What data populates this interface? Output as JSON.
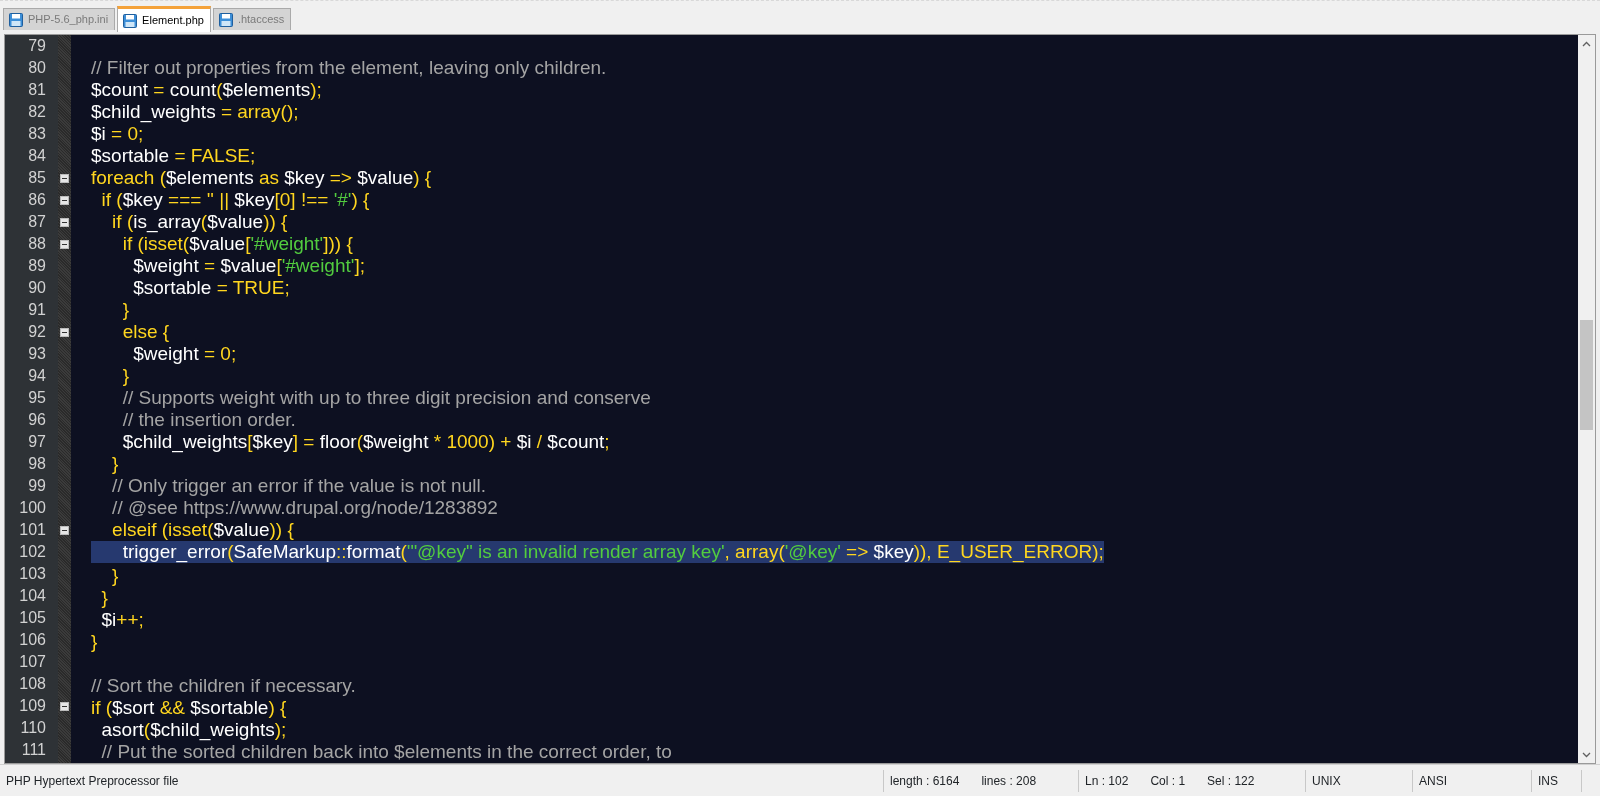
{
  "tabs": [
    {
      "label": "PHP-5.6_php.ini",
      "selected": false
    },
    {
      "label": "Element.php",
      "selected": true
    },
    {
      "label": ".htaccess",
      "selected": false
    }
  ],
  "editor": {
    "lines": [
      {
        "number": "79",
        "fold": false,
        "selected": false
      },
      {
        "number": "80",
        "fold": false,
        "selected": false,
        "tokens": [
          {
            "text": "// Filter out properties from the element, leaving only children.",
            "kind": "comment"
          }
        ]
      },
      {
        "number": "81",
        "fold": false,
        "selected": false,
        "tokens": [
          {
            "text": "$count ",
            "kind": "plain"
          },
          {
            "text": "= ",
            "kind": "keyword"
          },
          {
            "text": "count",
            "kind": "plain"
          },
          {
            "text": "(",
            "kind": "keyword"
          },
          {
            "text": "$elements",
            "kind": "plain"
          },
          {
            "text": ");",
            "kind": "keyword"
          }
        ]
      },
      {
        "number": "82",
        "fold": false,
        "selected": false,
        "tokens": [
          {
            "text": "$child_weights ",
            "kind": "plain"
          },
          {
            "text": "= array();",
            "kind": "keyword"
          }
        ]
      },
      {
        "number": "83",
        "fold": false,
        "selected": false,
        "tokens": [
          {
            "text": "$i ",
            "kind": "plain"
          },
          {
            "text": "= 0;",
            "kind": "keyword"
          }
        ]
      },
      {
        "number": "84",
        "fold": false,
        "selected": false,
        "tokens": [
          {
            "text": "$sortable ",
            "kind": "plain"
          },
          {
            "text": "= FALSE;",
            "kind": "keyword"
          }
        ]
      },
      {
        "number": "85",
        "fold": true,
        "selected": false,
        "tokens": [
          {
            "text": "foreach (",
            "kind": "keyword"
          },
          {
            "text": "$elements ",
            "kind": "plain"
          },
          {
            "text": "as ",
            "kind": "keyword"
          },
          {
            "text": "$key ",
            "kind": "plain"
          },
          {
            "text": "=> ",
            "kind": "keyword"
          },
          {
            "text": "$value",
            "kind": "plain"
          },
          {
            "text": ") {",
            "kind": "keyword"
          }
        ]
      },
      {
        "number": "86",
        "fold": true,
        "selected": false,
        "tokens": [
          {
            "text": "  if (",
            "kind": "keyword"
          },
          {
            "text": "$key ",
            "kind": "plain"
          },
          {
            "text": "=== '' || ",
            "kind": "keyword"
          },
          {
            "text": "$key",
            "kind": "plain"
          },
          {
            "text": "[0] !== ",
            "kind": "keyword"
          },
          {
            "text": "'#'",
            "kind": "string"
          },
          {
            "text": ") {",
            "kind": "keyword"
          }
        ]
      },
      {
        "number": "87",
        "fold": true,
        "selected": false,
        "tokens": [
          {
            "text": "    if (",
            "kind": "keyword"
          },
          {
            "text": "is_array",
            "kind": "plain"
          },
          {
            "text": "(",
            "kind": "keyword"
          },
          {
            "text": "$value",
            "kind": "plain"
          },
          {
            "text": ")) {",
            "kind": "keyword"
          }
        ]
      },
      {
        "number": "88",
        "fold": true,
        "selected": false,
        "tokens": [
          {
            "text": "      if (isset(",
            "kind": "keyword"
          },
          {
            "text": "$value",
            "kind": "plain"
          },
          {
            "text": "[",
            "kind": "keyword"
          },
          {
            "text": "'#weight'",
            "kind": "string"
          },
          {
            "text": "])) {",
            "kind": "keyword"
          }
        ]
      },
      {
        "number": "89",
        "fold": false,
        "selected": false,
        "tokens": [
          {
            "text": "        $weight ",
            "kind": "plain"
          },
          {
            "text": "= ",
            "kind": "keyword"
          },
          {
            "text": "$value",
            "kind": "plain"
          },
          {
            "text": "[",
            "kind": "keyword"
          },
          {
            "text": "'#weight'",
            "kind": "string"
          },
          {
            "text": "];",
            "kind": "keyword"
          }
        ]
      },
      {
        "number": "90",
        "fold": false,
        "selected": false,
        "tokens": [
          {
            "text": "        $sortable ",
            "kind": "plain"
          },
          {
            "text": "= TRUE;",
            "kind": "keyword"
          }
        ]
      },
      {
        "number": "91",
        "fold": false,
        "selected": false,
        "tokens": [
          {
            "text": "      }",
            "kind": "keyword"
          }
        ]
      },
      {
        "number": "92",
        "fold": true,
        "selected": false,
        "tokens": [
          {
            "text": "      else {",
            "kind": "keyword"
          }
        ]
      },
      {
        "number": "93",
        "fold": false,
        "selected": false,
        "tokens": [
          {
            "text": "        $weight ",
            "kind": "plain"
          },
          {
            "text": "= 0;",
            "kind": "keyword"
          }
        ]
      },
      {
        "number": "94",
        "fold": false,
        "selected": false,
        "tokens": [
          {
            "text": "      }",
            "kind": "keyword"
          }
        ]
      },
      {
        "number": "95",
        "fold": false,
        "selected": false,
        "tokens": [
          {
            "text": "      // Supports weight with up to three digit precision and conserve",
            "kind": "comment"
          }
        ]
      },
      {
        "number": "96",
        "fold": false,
        "selected": false,
        "tokens": [
          {
            "text": "      // the insertion order.",
            "kind": "comment"
          }
        ]
      },
      {
        "number": "97",
        "fold": false,
        "selected": false,
        "tokens": [
          {
            "text": "      $child_weights",
            "kind": "plain"
          },
          {
            "text": "[",
            "kind": "keyword"
          },
          {
            "text": "$key",
            "kind": "plain"
          },
          {
            "text": "] = ",
            "kind": "keyword"
          },
          {
            "text": "floor",
            "kind": "plain"
          },
          {
            "text": "(",
            "kind": "keyword"
          },
          {
            "text": "$weight ",
            "kind": "plain"
          },
          {
            "text": "* 1000) + ",
            "kind": "keyword"
          },
          {
            "text": "$i ",
            "kind": "plain"
          },
          {
            "text": "/ ",
            "kind": "keyword"
          },
          {
            "text": "$count",
            "kind": "plain"
          },
          {
            "text": ";",
            "kind": "keyword"
          }
        ]
      },
      {
        "number": "98",
        "fold": false,
        "selected": false,
        "tokens": [
          {
            "text": "    }",
            "kind": "keyword"
          }
        ]
      },
      {
        "number": "99",
        "fold": false,
        "selected": false,
        "tokens": [
          {
            "text": "    // Only trigger an error if the value is not null.",
            "kind": "comment"
          }
        ]
      },
      {
        "number": "100",
        "fold": false,
        "selected": false,
        "tokens": [
          {
            "text": "    // @see https://www.drupal.org/node/1283892",
            "kind": "comment"
          }
        ]
      },
      {
        "number": "101",
        "fold": true,
        "selected": false,
        "tokens": [
          {
            "text": "    elseif (isset(",
            "kind": "keyword"
          },
          {
            "text": "$value",
            "kind": "plain"
          },
          {
            "text": ")) {",
            "kind": "keyword"
          }
        ]
      },
      {
        "number": "102",
        "fold": false,
        "selected": true,
        "tokens": [
          {
            "text": "      trigger_error",
            "kind": "plain"
          },
          {
            "text": "(",
            "kind": "keyword"
          },
          {
            "text": "SafeMarkup",
            "kind": "plain"
          },
          {
            "text": "::",
            "kind": "keyword"
          },
          {
            "text": "format",
            "kind": "plain"
          },
          {
            "text": "(",
            "kind": "keyword"
          },
          {
            "text": "'\"@key\" is an invalid render array key'",
            "kind": "string"
          },
          {
            "text": ", array(",
            "kind": "keyword"
          },
          {
            "text": "'@key'",
            "kind": "string"
          },
          {
            "text": " => ",
            "kind": "keyword"
          },
          {
            "text": "$key",
            "kind": "plain"
          },
          {
            "text": ")), E_USER_ERROR);",
            "kind": "keyword"
          }
        ]
      },
      {
        "number": "103",
        "fold": false,
        "selected": false,
        "tokens": [
          {
            "text": "    }",
            "kind": "keyword"
          }
        ]
      },
      {
        "number": "104",
        "fold": false,
        "selected": false,
        "tokens": [
          {
            "text": "  }",
            "kind": "keyword"
          }
        ]
      },
      {
        "number": "105",
        "fold": false,
        "selected": false,
        "tokens": [
          {
            "text": "  $i",
            "kind": "plain"
          },
          {
            "text": "++;",
            "kind": "keyword"
          }
        ]
      },
      {
        "number": "106",
        "fold": false,
        "selected": false,
        "tokens": [
          {
            "text": "}",
            "kind": "keyword"
          }
        ]
      },
      {
        "number": "107",
        "fold": false,
        "selected": false
      },
      {
        "number": "108",
        "fold": false,
        "selected": false,
        "tokens": [
          {
            "text": "// Sort the children if necessary.",
            "kind": "comment"
          }
        ]
      },
      {
        "number": "109",
        "fold": true,
        "selected": false,
        "tokens": [
          {
            "text": "if (",
            "kind": "keyword"
          },
          {
            "text": "$sort ",
            "kind": "plain"
          },
          {
            "text": "&& ",
            "kind": "keyword"
          },
          {
            "text": "$sortable",
            "kind": "plain"
          },
          {
            "text": ") {",
            "kind": "keyword"
          }
        ]
      },
      {
        "number": "110",
        "fold": false,
        "selected": false,
        "tokens": [
          {
            "text": "  asort",
            "kind": "plain"
          },
          {
            "text": "(",
            "kind": "keyword"
          },
          {
            "text": "$child_weights",
            "kind": "plain"
          },
          {
            "text": ");",
            "kind": "keyword"
          }
        ]
      },
      {
        "number": "111",
        "fold": false,
        "selected": false,
        "tokens": [
          {
            "text": "  // Put the sorted children back into $elements in the correct order, to",
            "kind": "comment"
          }
        ]
      }
    ]
  },
  "status_bar": {
    "file_type": "PHP Hypertext Preprocessor file",
    "length": "length : 6164",
    "lines": "lines : 208",
    "line": "Ln : 102",
    "column": "Col : 1",
    "selection": "Sel : 122",
    "eol": "UNIX",
    "encoding": "ANSI",
    "mode": "INS"
  }
}
